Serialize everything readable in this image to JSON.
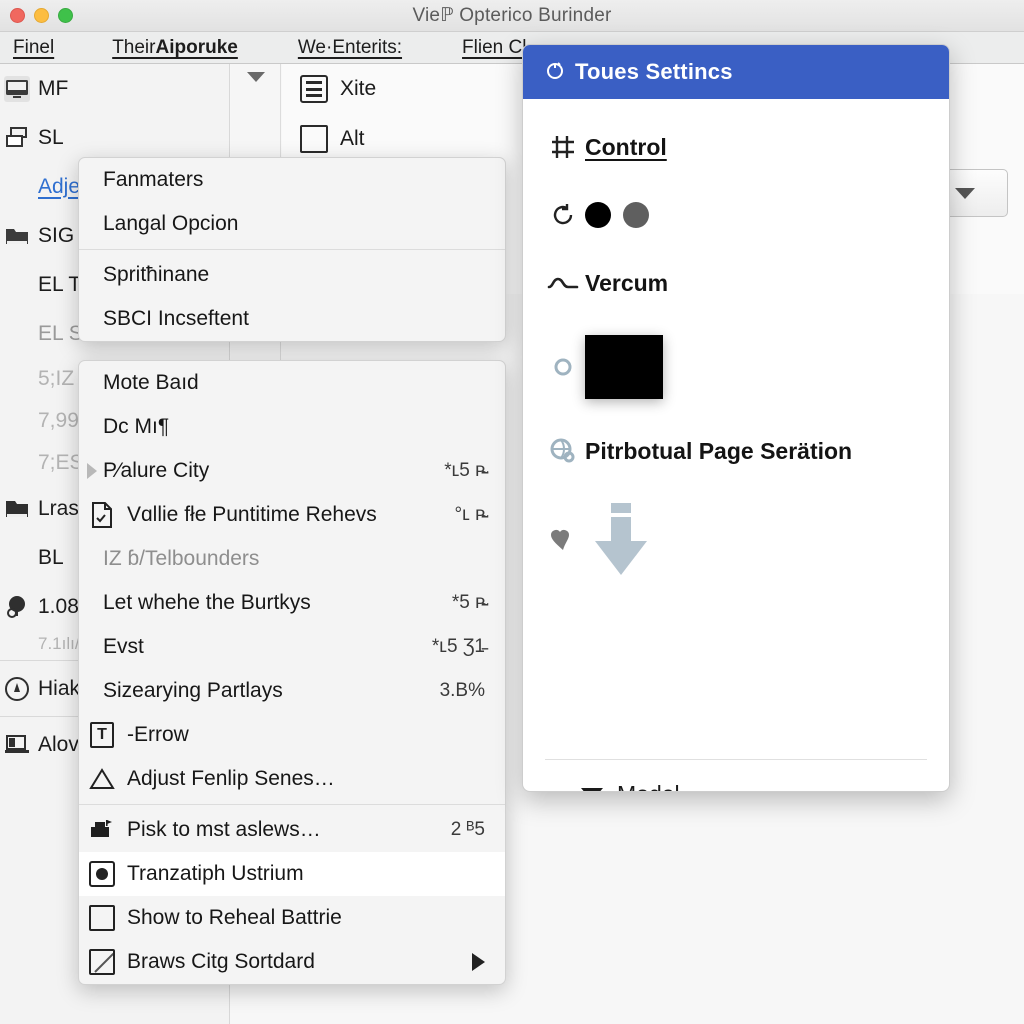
{
  "window": {
    "title": "Vieℙ Opterico Burinder",
    "traffic_lights": [
      "close-red",
      "minimize-amber",
      "zoom-green"
    ]
  },
  "menubar": {
    "items": [
      {
        "label": "Finel",
        "bold": false
      },
      {
        "label": "Their",
        "bold": false
      },
      {
        "label": "Aiporuke",
        "bold": true
      },
      {
        "label": "We·Enterits:",
        "bold": false
      },
      {
        "label": "Flien Cl…",
        "bold": false
      }
    ]
  },
  "sidebar": {
    "items": [
      {
        "label": "MF",
        "icon": "monitor-icon",
        "style": "normal",
        "selected_icon": true
      },
      {
        "label": "SL",
        "icon": "layers-icon",
        "style": "normal"
      },
      {
        "label": "Adje",
        "icon": "none",
        "style": "link"
      },
      {
        "label": "SIG",
        "icon": "folder-icon",
        "style": "normal"
      },
      {
        "label": "EL T",
        "icon": "none",
        "style": "normal"
      },
      {
        "label": "EL S",
        "icon": "none",
        "style": "muted"
      },
      {
        "label": "5;IZ",
        "icon": "none",
        "style": "muted2"
      },
      {
        "label": "7,99",
        "icon": "none",
        "style": "muted2"
      },
      {
        "label": "7;ES",
        "icon": "none",
        "style": "muted2"
      },
      {
        "label": "Lras;",
        "icon": "folder-dark-icon",
        "style": "normal"
      },
      {
        "label": "BL",
        "icon": "none",
        "style": "normal"
      },
      {
        "label": "1.08",
        "icon": "search-lamp-icon",
        "style": "normal"
      },
      {
        "label": "7.1ılı/",
        "icon": "none",
        "style": "muted2"
      },
      {
        "label": "Hiak",
        "icon": "clock-icon",
        "style": "normal"
      },
      {
        "label": "Alov",
        "icon": "laptop-icon",
        "style": "normal"
      }
    ]
  },
  "toolpanel": {
    "items": [
      {
        "label": "Xite",
        "icon": "list-view-icon"
      },
      {
        "label": "Alt",
        "icon": "square-icon"
      }
    ],
    "collapse_caret": "chevron-down-icon"
  },
  "combo": {
    "caret": "chevron-down-icon"
  },
  "context_menu_a": {
    "groups": [
      {
        "items": [
          {
            "label": "Fanmaters",
            "icon": "none",
            "accel": ""
          },
          {
            "label": "Langal Opcion",
            "icon": "none",
            "accel": ""
          }
        ]
      },
      {
        "items": [
          {
            "label": "Spritħinane",
            "icon": "none",
            "accel": ""
          },
          {
            "label": "SBCI Incseftent",
            "icon": "none",
            "accel": ""
          }
        ]
      }
    ]
  },
  "context_menu_b": {
    "groups": [
      {
        "items": [
          {
            "label": "Mote Baıd",
            "icon": "none",
            "accel": ""
          },
          {
            "label": "Dc Mı¶",
            "icon": "none",
            "accel": ""
          },
          {
            "label": "P⁄alure City",
            "icon": "left-arrow-marker",
            "accel": "*ʟ5 ᴘ̵̴̵"
          },
          {
            "label": "Vɑllie fłe Puntitime Rehevs",
            "icon": "file-check-icon",
            "accel": "°ʟ ᴘ̵̴"
          },
          {
            "label": "IZ  ɓ/Telbounders",
            "icon": "none",
            "accel": "",
            "ghost": true
          },
          {
            "label": "Let whehe the Burtkys",
            "icon": "none",
            "accel": "*5 ᴘ̵̴"
          },
          {
            "label": "Evst",
            "icon": "none",
            "accel": "*ʟ5 Ʒ1̵"
          },
          {
            "label": "Sizearying Partlays",
            "icon": "none",
            "accel": "3.B%"
          },
          {
            "label": "-Errow",
            "icon": "text-tool-icon",
            "accel": ""
          },
          {
            "label": "Adjust Fenlip Senes…",
            "icon": "triangle-outline-icon",
            "accel": ""
          }
        ]
      },
      {
        "items": [
          {
            "label": "Pisk to mst aslews…",
            "icon": "printer-icon",
            "accel": "2 ᴮ5"
          },
          {
            "label": "Tranzatiph Ustrium",
            "icon": "radio-checked-icon",
            "accel": "",
            "highlighted": true
          },
          {
            "label": "Show to Reheal Battrie",
            "icon": "checkbox-empty-icon",
            "accel": ""
          },
          {
            "label": "Braws Citg Sortdard",
            "icon": "checkbox-slash-icon",
            "submenu": true
          }
        ]
      }
    ]
  },
  "settings_dialog": {
    "title": "Toues Settincs",
    "title_icon": "gear-small-icon",
    "title_bg": "#3a5fc4",
    "rows": [
      {
        "kind": "label",
        "icon": "grid-hash-icon",
        "label": "Control",
        "underline_first": true
      },
      {
        "kind": "dots",
        "icon": "refresh-icon",
        "dots": [
          "#000000",
          "#5f5f5f"
        ]
      },
      {
        "kind": "label",
        "icon": "wave-line-icon",
        "label": "Vercum"
      },
      {
        "kind": "swatch",
        "icon": "circle-small-icon",
        "color": "#000000"
      },
      {
        "kind": "label",
        "icon": "globe-search-icon",
        "label": "Pitrbotual Page Serätion"
      },
      {
        "kind": "arrow",
        "icon": "heart-icon",
        "arrow_color": "#b5c4cf"
      }
    ],
    "footer": {
      "caret": "caret-down-icon",
      "label": "Model"
    }
  }
}
